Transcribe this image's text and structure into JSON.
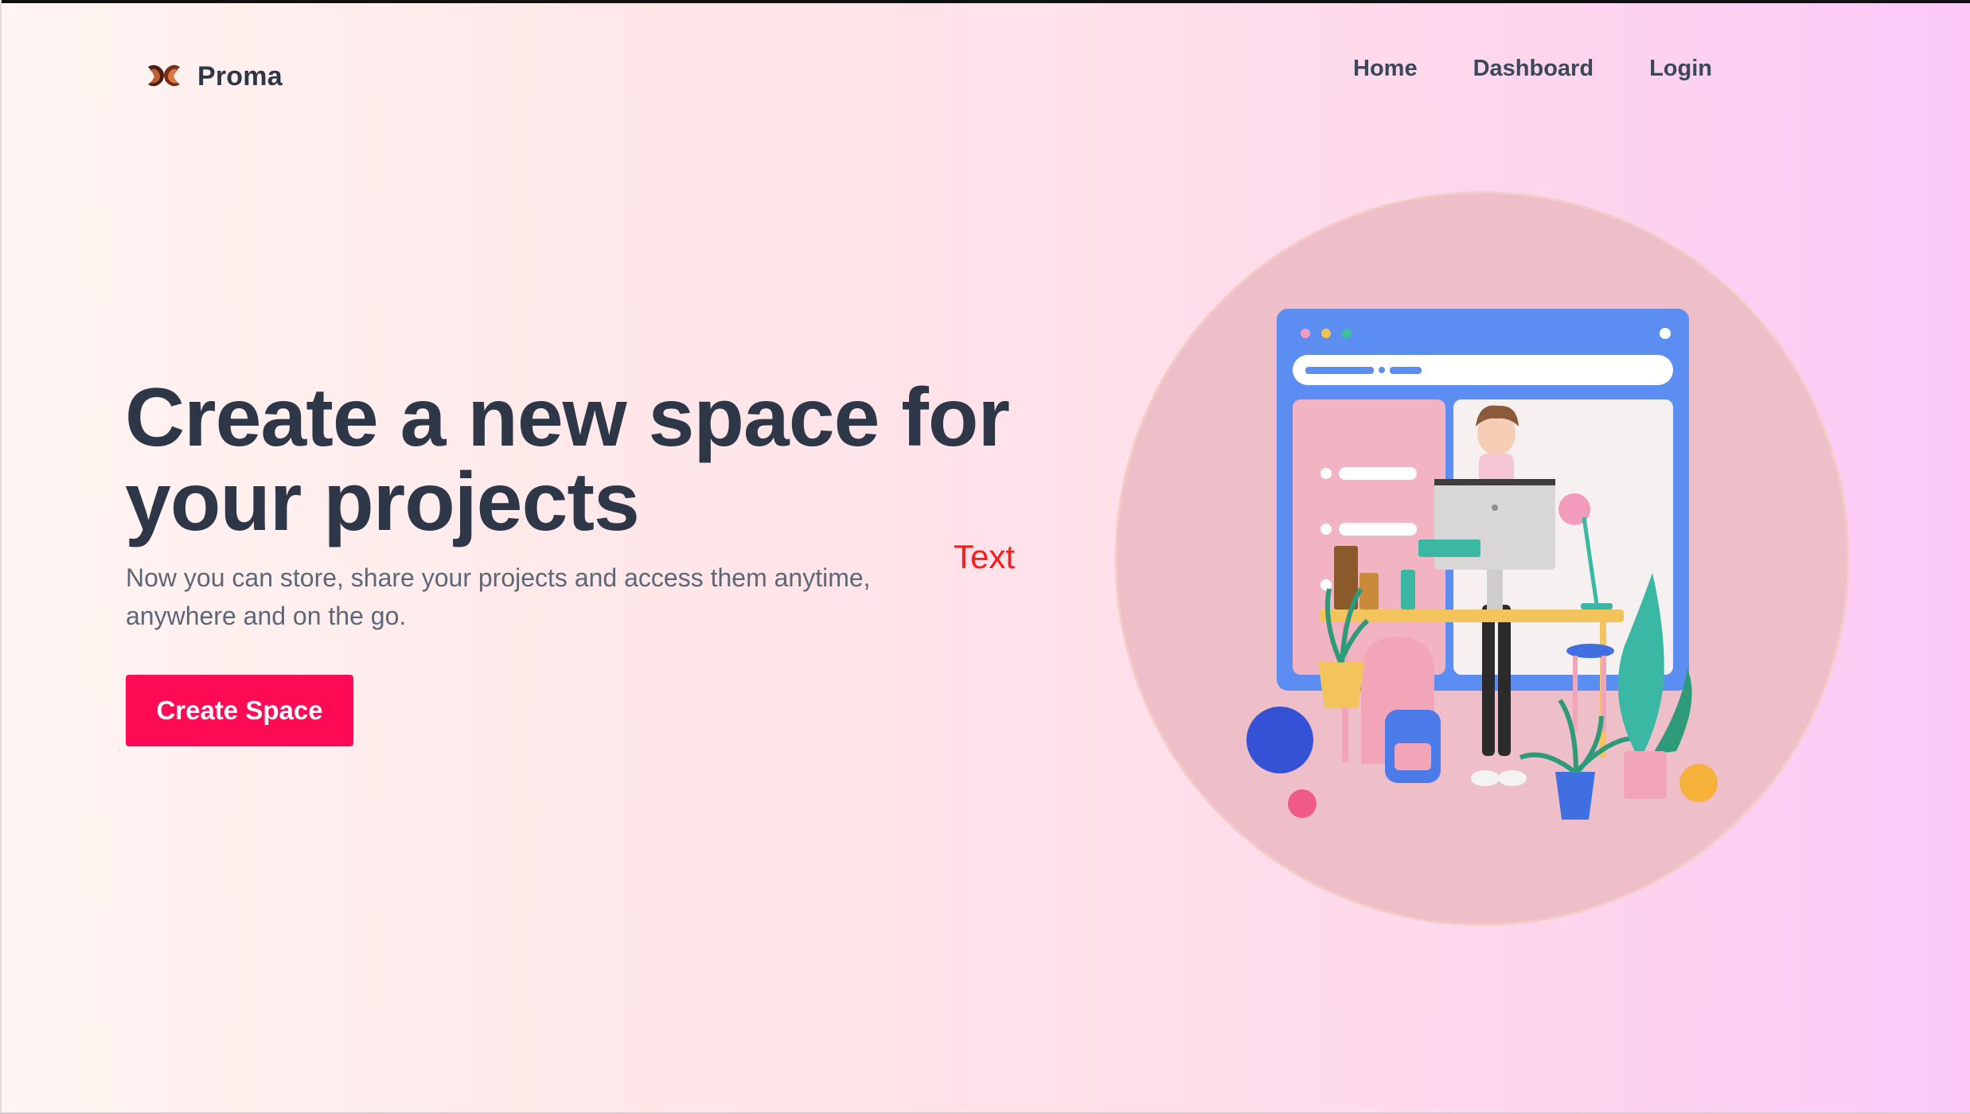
{
  "brand": {
    "name": "Proma"
  },
  "nav": {
    "home": "Home",
    "dashboard": "Dashboard",
    "login": "Login"
  },
  "hero": {
    "title": "Create a new space for your projects",
    "subtitle": "Now you can store, share your projects and access them anytime, anywhere and on the go.",
    "cta": "Create Space",
    "stray_text": "Text"
  },
  "colors": {
    "accent": "#ff0a54",
    "heading": "#2d3748",
    "stray_text": "#ff1a1a"
  },
  "illustration": {
    "icon": "workspace-3d-illustration"
  }
}
